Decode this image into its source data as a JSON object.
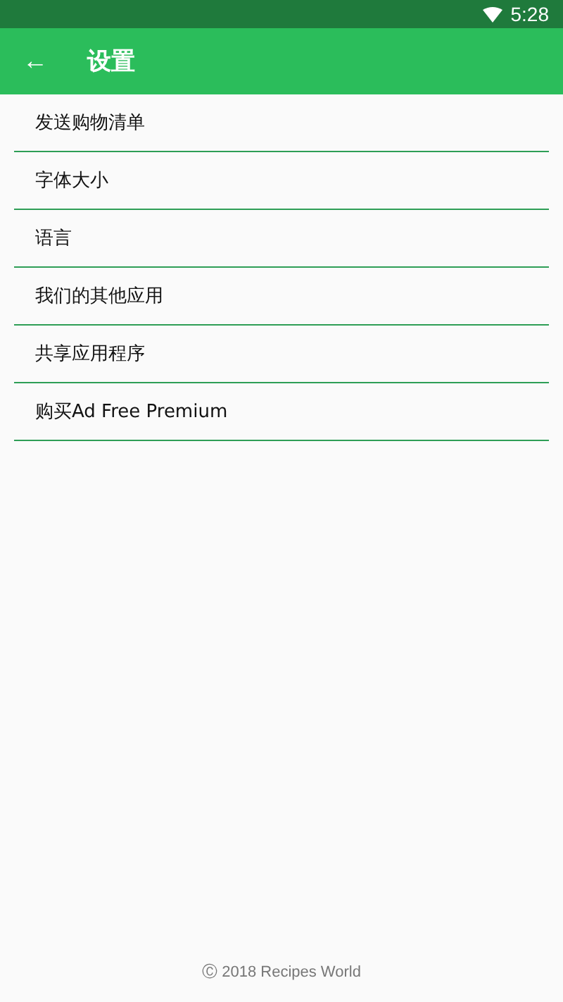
{
  "status_bar": {
    "time": "5:28"
  },
  "app_bar": {
    "back": "←",
    "title": "设置"
  },
  "items": [
    {
      "label": "发送购物清单"
    },
    {
      "label": "字体大小"
    },
    {
      "label": "语言"
    },
    {
      "label": "我们的其他应用"
    },
    {
      "label": "共享应用程序"
    },
    {
      "label": "购买Ad Free Premium"
    }
  ],
  "footer": "Ⓒ 2018 Recipes World"
}
